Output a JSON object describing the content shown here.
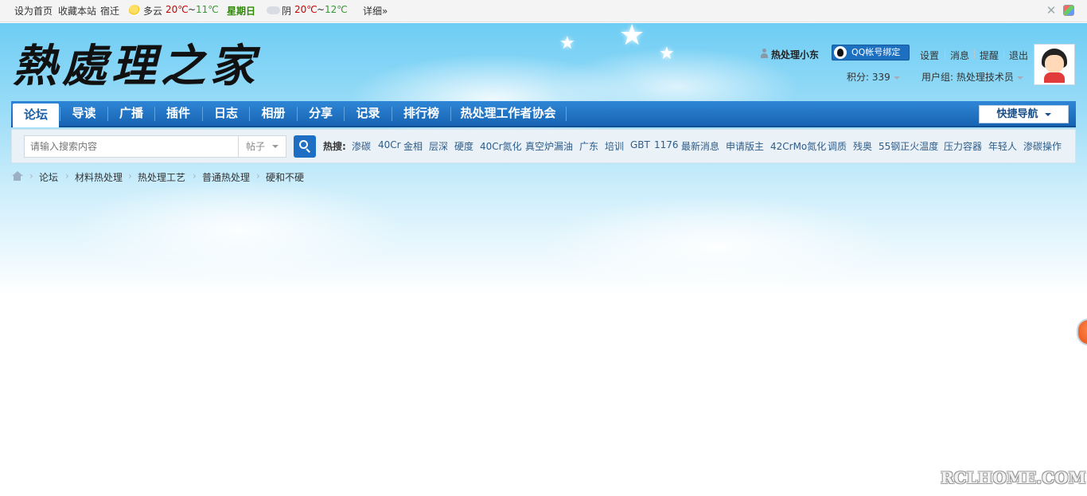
{
  "topbar": {
    "set_home": "设为首页",
    "bookmark": "收藏本站",
    "city": "宿迁",
    "today_weather": "多云",
    "today_high": "20℃",
    "tilde1": "~",
    "today_low": "11℃",
    "weekday": "星期日",
    "tomorrow_weather": "阴",
    "tomorrow_high": "20℃",
    "tilde2": "~",
    "tomorrow_low": "12℃",
    "details": "详细»"
  },
  "header": {
    "logo_text": "熱處理之家",
    "username": "热处理小东",
    "qq_bind": "QQ帐号绑定",
    "links": [
      "设置",
      "消息",
      "提醒",
      "退出"
    ],
    "points_label": "积分: 339",
    "usergroup_label": "用户组: 热处理技术员"
  },
  "nav": {
    "items": [
      "论坛",
      "导读",
      "广播",
      "插件",
      "日志",
      "相册",
      "分享",
      "记录",
      "排行榜",
      "热处理工作者协会"
    ],
    "active_index": 0,
    "quick_nav": "快捷导航"
  },
  "search": {
    "placeholder": "请输入搜索内容",
    "type": "帖子",
    "hot_label": "热搜:",
    "hot_words": [
      "渗碳",
      "40Cr",
      "金相",
      "层深",
      "硬度",
      "40Cr氮化",
      "真空炉漏油",
      "广东",
      "培训",
      "GBT",
      "1176",
      "最新消息",
      "申请版主",
      "42CrMo氮化",
      "调质",
      "残奥",
      "55钢正火温度",
      "压力容器",
      "年轻人",
      "渗碳操作"
    ]
  },
  "breadcrumb": [
    "论坛",
    "材料热处理",
    "热处理工艺",
    "普通热处理",
    "硬和不硬"
  ],
  "watermark": "RCLHOME.COM",
  "colors": {
    "nav_blue": "#1f6fc2",
    "hot_temp": "#cc0000",
    "low_temp": "#339933",
    "weekday": "#2b8a00",
    "hotword_link": "#2f5d8a"
  }
}
